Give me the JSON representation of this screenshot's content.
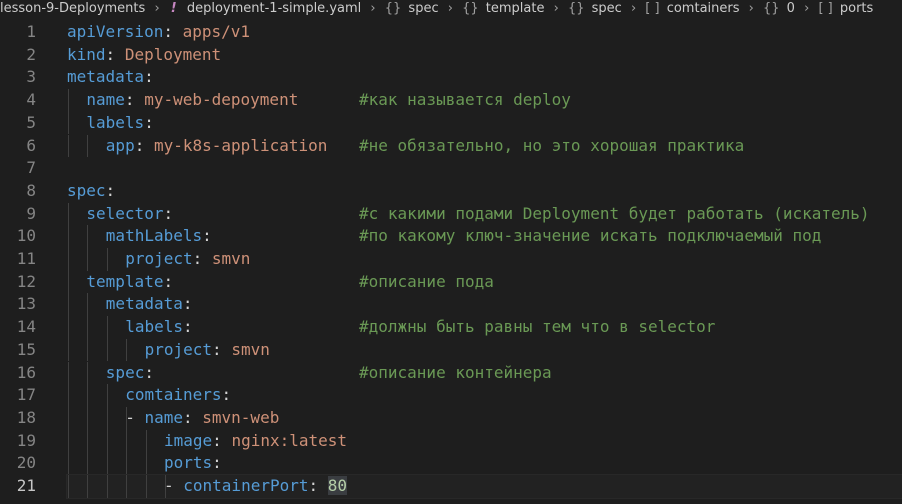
{
  "breadcrumb": {
    "folder": "lesson-9-Deployments",
    "file_icon": "!",
    "file": "deployment-1-simple.yaml",
    "path": [
      {
        "icon": "{}",
        "label": "spec"
      },
      {
        "icon": "{}",
        "label": "template"
      },
      {
        "icon": "{}",
        "label": "spec"
      },
      {
        "icon": "[ ]",
        "label": "comtainers"
      },
      {
        "icon": "{}",
        "label": "0"
      },
      {
        "icon": "[ ]",
        "label": "ports"
      }
    ]
  },
  "editor": {
    "current_line": 21,
    "lines": [
      {
        "num": "1",
        "key": "apiVersion",
        "value": "apps/v1",
        "comment": ""
      },
      {
        "num": "2",
        "key": "kind",
        "value": "Deployment",
        "comment": ""
      },
      {
        "num": "3",
        "key": "metadata",
        "value": "",
        "comment": ""
      },
      {
        "num": "4",
        "key": "name",
        "value": "my-web-depoyment",
        "comment": "#как называется deploy"
      },
      {
        "num": "5",
        "key": "labels",
        "value": "",
        "comment": ""
      },
      {
        "num": "6",
        "key": "app",
        "value": "my-k8s-application",
        "comment": "#не обязательно, но это хорошая практика"
      },
      {
        "num": "7",
        "key": "",
        "value": "",
        "comment": ""
      },
      {
        "num": "8",
        "key": "spec",
        "value": "",
        "comment": ""
      },
      {
        "num": "9",
        "key": "selector",
        "value": "",
        "comment": "#с какими подами Deployment будет работать (искатель)"
      },
      {
        "num": "10",
        "key": "mathLabels",
        "value": "",
        "comment": "#по какому ключ-значение искать подключаемый под"
      },
      {
        "num": "11",
        "key": "project",
        "value": "smvn",
        "comment": ""
      },
      {
        "num": "12",
        "key": "template",
        "value": "",
        "comment": "#описание пода"
      },
      {
        "num": "13",
        "key": "metadata",
        "value": "",
        "comment": ""
      },
      {
        "num": "14",
        "key": "labels",
        "value": "",
        "comment": "#должны быть равны тем что в selector"
      },
      {
        "num": "15",
        "key": "project",
        "value": "smvn",
        "comment": ""
      },
      {
        "num": "16",
        "key": "spec",
        "value": "",
        "comment": "#описание контейнера"
      },
      {
        "num": "17",
        "key": "comtainers",
        "value": "",
        "comment": ""
      },
      {
        "num": "18",
        "key": "name",
        "value": "smvn-web",
        "comment": ""
      },
      {
        "num": "19",
        "key": "image",
        "value": "nginx:latest",
        "comment": ""
      },
      {
        "num": "20",
        "key": "ports",
        "value": "",
        "comment": ""
      },
      {
        "num": "21",
        "key": "containerPort",
        "value": "80",
        "comment": ""
      }
    ]
  }
}
